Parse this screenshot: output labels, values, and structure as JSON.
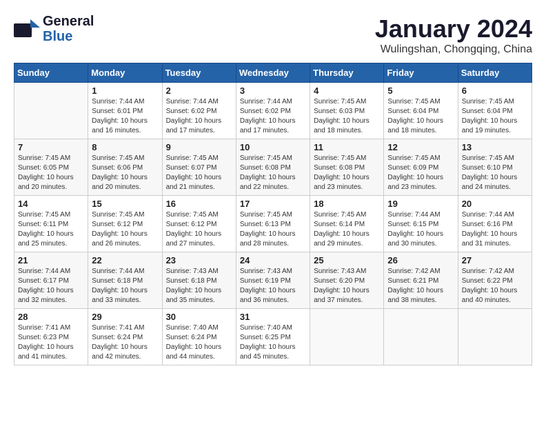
{
  "header": {
    "logo_general": "General",
    "logo_blue": "Blue",
    "month_title": "January 2024",
    "location": "Wulingshan, Chongqing, China"
  },
  "days_of_week": [
    "Sunday",
    "Monday",
    "Tuesday",
    "Wednesday",
    "Thursday",
    "Friday",
    "Saturday"
  ],
  "weeks": [
    [
      {
        "num": "",
        "sunrise": "",
        "sunset": "",
        "daylight": ""
      },
      {
        "num": "1",
        "sunrise": "Sunrise: 7:44 AM",
        "sunset": "Sunset: 6:01 PM",
        "daylight": "Daylight: 10 hours and 16 minutes."
      },
      {
        "num": "2",
        "sunrise": "Sunrise: 7:44 AM",
        "sunset": "Sunset: 6:02 PM",
        "daylight": "Daylight: 10 hours and 17 minutes."
      },
      {
        "num": "3",
        "sunrise": "Sunrise: 7:44 AM",
        "sunset": "Sunset: 6:02 PM",
        "daylight": "Daylight: 10 hours and 17 minutes."
      },
      {
        "num": "4",
        "sunrise": "Sunrise: 7:45 AM",
        "sunset": "Sunset: 6:03 PM",
        "daylight": "Daylight: 10 hours and 18 minutes."
      },
      {
        "num": "5",
        "sunrise": "Sunrise: 7:45 AM",
        "sunset": "Sunset: 6:04 PM",
        "daylight": "Daylight: 10 hours and 18 minutes."
      },
      {
        "num": "6",
        "sunrise": "Sunrise: 7:45 AM",
        "sunset": "Sunset: 6:04 PM",
        "daylight": "Daylight: 10 hours and 19 minutes."
      }
    ],
    [
      {
        "num": "7",
        "sunrise": "Sunrise: 7:45 AM",
        "sunset": "Sunset: 6:05 PM",
        "daylight": "Daylight: 10 hours and 20 minutes."
      },
      {
        "num": "8",
        "sunrise": "Sunrise: 7:45 AM",
        "sunset": "Sunset: 6:06 PM",
        "daylight": "Daylight: 10 hours and 20 minutes."
      },
      {
        "num": "9",
        "sunrise": "Sunrise: 7:45 AM",
        "sunset": "Sunset: 6:07 PM",
        "daylight": "Daylight: 10 hours and 21 minutes."
      },
      {
        "num": "10",
        "sunrise": "Sunrise: 7:45 AM",
        "sunset": "Sunset: 6:08 PM",
        "daylight": "Daylight: 10 hours and 22 minutes."
      },
      {
        "num": "11",
        "sunrise": "Sunrise: 7:45 AM",
        "sunset": "Sunset: 6:08 PM",
        "daylight": "Daylight: 10 hours and 23 minutes."
      },
      {
        "num": "12",
        "sunrise": "Sunrise: 7:45 AM",
        "sunset": "Sunset: 6:09 PM",
        "daylight": "Daylight: 10 hours and 23 minutes."
      },
      {
        "num": "13",
        "sunrise": "Sunrise: 7:45 AM",
        "sunset": "Sunset: 6:10 PM",
        "daylight": "Daylight: 10 hours and 24 minutes."
      }
    ],
    [
      {
        "num": "14",
        "sunrise": "Sunrise: 7:45 AM",
        "sunset": "Sunset: 6:11 PM",
        "daylight": "Daylight: 10 hours and 25 minutes."
      },
      {
        "num": "15",
        "sunrise": "Sunrise: 7:45 AM",
        "sunset": "Sunset: 6:12 PM",
        "daylight": "Daylight: 10 hours and 26 minutes."
      },
      {
        "num": "16",
        "sunrise": "Sunrise: 7:45 AM",
        "sunset": "Sunset: 6:12 PM",
        "daylight": "Daylight: 10 hours and 27 minutes."
      },
      {
        "num": "17",
        "sunrise": "Sunrise: 7:45 AM",
        "sunset": "Sunset: 6:13 PM",
        "daylight": "Daylight: 10 hours and 28 minutes."
      },
      {
        "num": "18",
        "sunrise": "Sunrise: 7:45 AM",
        "sunset": "Sunset: 6:14 PM",
        "daylight": "Daylight: 10 hours and 29 minutes."
      },
      {
        "num": "19",
        "sunrise": "Sunrise: 7:44 AM",
        "sunset": "Sunset: 6:15 PM",
        "daylight": "Daylight: 10 hours and 30 minutes."
      },
      {
        "num": "20",
        "sunrise": "Sunrise: 7:44 AM",
        "sunset": "Sunset: 6:16 PM",
        "daylight": "Daylight: 10 hours and 31 minutes."
      }
    ],
    [
      {
        "num": "21",
        "sunrise": "Sunrise: 7:44 AM",
        "sunset": "Sunset: 6:17 PM",
        "daylight": "Daylight: 10 hours and 32 minutes."
      },
      {
        "num": "22",
        "sunrise": "Sunrise: 7:44 AM",
        "sunset": "Sunset: 6:18 PM",
        "daylight": "Daylight: 10 hours and 33 minutes."
      },
      {
        "num": "23",
        "sunrise": "Sunrise: 7:43 AM",
        "sunset": "Sunset: 6:18 PM",
        "daylight": "Daylight: 10 hours and 35 minutes."
      },
      {
        "num": "24",
        "sunrise": "Sunrise: 7:43 AM",
        "sunset": "Sunset: 6:19 PM",
        "daylight": "Daylight: 10 hours and 36 minutes."
      },
      {
        "num": "25",
        "sunrise": "Sunrise: 7:43 AM",
        "sunset": "Sunset: 6:20 PM",
        "daylight": "Daylight: 10 hours and 37 minutes."
      },
      {
        "num": "26",
        "sunrise": "Sunrise: 7:42 AM",
        "sunset": "Sunset: 6:21 PM",
        "daylight": "Daylight: 10 hours and 38 minutes."
      },
      {
        "num": "27",
        "sunrise": "Sunrise: 7:42 AM",
        "sunset": "Sunset: 6:22 PM",
        "daylight": "Daylight: 10 hours and 40 minutes."
      }
    ],
    [
      {
        "num": "28",
        "sunrise": "Sunrise: 7:41 AM",
        "sunset": "Sunset: 6:23 PM",
        "daylight": "Daylight: 10 hours and 41 minutes."
      },
      {
        "num": "29",
        "sunrise": "Sunrise: 7:41 AM",
        "sunset": "Sunset: 6:24 PM",
        "daylight": "Daylight: 10 hours and 42 minutes."
      },
      {
        "num": "30",
        "sunrise": "Sunrise: 7:40 AM",
        "sunset": "Sunset: 6:24 PM",
        "daylight": "Daylight: 10 hours and 44 minutes."
      },
      {
        "num": "31",
        "sunrise": "Sunrise: 7:40 AM",
        "sunset": "Sunset: 6:25 PM",
        "daylight": "Daylight: 10 hours and 45 minutes."
      },
      {
        "num": "",
        "sunrise": "",
        "sunset": "",
        "daylight": ""
      },
      {
        "num": "",
        "sunrise": "",
        "sunset": "",
        "daylight": ""
      },
      {
        "num": "",
        "sunrise": "",
        "sunset": "",
        "daylight": ""
      }
    ]
  ]
}
